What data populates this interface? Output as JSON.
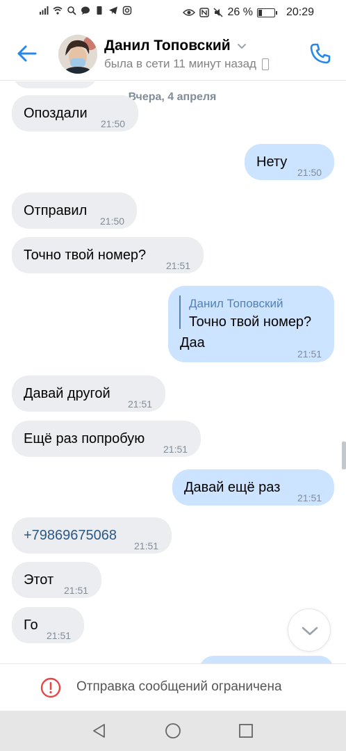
{
  "status_bar": {
    "battery_percent": "26 %",
    "battery_level": 0.26,
    "time": "20:29"
  },
  "header": {
    "contact_name": "Данил Топовский",
    "last_seen": "была в сети 11 минут назад",
    "accent_color": "#2688eb"
  },
  "chat": {
    "date_separator": "Вчера, 4 апреля",
    "messages": [
      {
        "direction": "in",
        "text": "Опоздали",
        "time": "21:50"
      },
      {
        "direction": "out",
        "text": "Нету",
        "time": "21:50"
      },
      {
        "direction": "in",
        "text": "Отправил",
        "time": "21:50"
      },
      {
        "direction": "in",
        "text": "Точно твой номер?",
        "time": "21:51"
      },
      {
        "direction": "out",
        "reply_author": "Данил Топовский",
        "reply_text": "Точно твой номер?",
        "text": "Даа",
        "time": "21:51"
      },
      {
        "direction": "in",
        "text": "Давай другой",
        "time": "21:51"
      },
      {
        "direction": "in",
        "text": "Ещё раз попробую",
        "time": "21:51"
      },
      {
        "direction": "out",
        "text": "Давай ещё раз",
        "time": "21:51"
      },
      {
        "direction": "in",
        "text": "+79869675068",
        "time": "21:51",
        "is_link": true
      },
      {
        "direction": "in",
        "text": "Этот",
        "time": "21:51"
      },
      {
        "direction": "in",
        "text": "Го",
        "time": "21:51"
      }
    ]
  },
  "footer": {
    "restricted_text": "Отправка сообщений ограничена",
    "warning_color": "#e64646"
  },
  "colors": {
    "incoming_bubble": "#ebedf0",
    "outgoing_bubble": "#cce4ff",
    "link": "#2a5885"
  }
}
